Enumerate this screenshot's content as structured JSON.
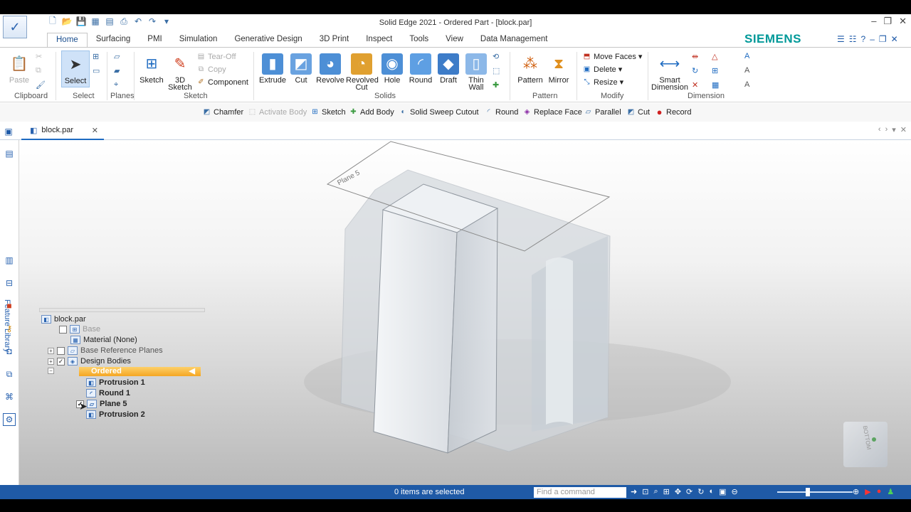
{
  "window": {
    "title": "Solid Edge 2021 - Ordered Part - [block.par]",
    "controls": [
      "–",
      "❐",
      "✕"
    ]
  },
  "tabs": [
    "Home",
    "Surfacing",
    "PMI",
    "Simulation",
    "Generative Design",
    "3D Print",
    "Inspect",
    "Tools",
    "View",
    "Data Management"
  ],
  "active_tab": "Home",
  "brand": "SIEMENS",
  "ribbon": {
    "paste": "Paste",
    "select": "Select",
    "sketch": "Sketch",
    "sketch3d_1": "3D",
    "sketch3d_2": "Sketch",
    "tearoff": "Tear-Off",
    "copy": "Copy",
    "component": "Component",
    "extrude": "Extrude",
    "cut": "Cut",
    "revolve": "Revolve",
    "revolved_cut_1": "Revolved",
    "revolved_cut_2": "Cut",
    "hole": "Hole",
    "round": "Round",
    "draft": "Draft",
    "thin_wall_1": "Thin",
    "thin_wall_2": "Wall",
    "pattern": "Pattern",
    "mirror": "Mirror",
    "move_faces": "Move Faces",
    "delete": "Delete",
    "resize": "Resize",
    "smart_dimension_1": "Smart",
    "smart_dimension_2": "Dimension",
    "groups": {
      "clipboard": "Clipboard",
      "select": "Select",
      "planes": "Planes",
      "sketch": "Sketch",
      "solids": "Solids",
      "pattern": "Pattern",
      "modify": "Modify",
      "dimension": "Dimension"
    }
  },
  "command_bar": [
    "Chamfer",
    "Activate Body",
    "Sketch",
    "Add Body",
    "Solid Sweep Cutout",
    "Round",
    "Replace Face",
    "Parallel",
    "Cut",
    "Record"
  ],
  "document_tab": "block.par",
  "left_bar_label": "Feature Library",
  "tree": {
    "root": "block.par",
    "base": "Base",
    "material": "Material (None)",
    "base_ref_planes": "Base Reference Planes",
    "design_bodies": "Design Bodies",
    "ordered": "Ordered",
    "protrusion1": "Protrusion 1",
    "round1": "Round 1",
    "plane5": "Plane 5",
    "protrusion2": "Protrusion 2"
  },
  "viewport": {
    "plane_label": "Plane 5",
    "cube_label": "BOTTOM"
  },
  "status": {
    "selected": "0 items are selected",
    "find_placeholder": "Find a command"
  },
  "colors": {
    "status_bar": "#1f5aa6",
    "ordered_highlight": "#f5a623",
    "brand": "#009999"
  }
}
